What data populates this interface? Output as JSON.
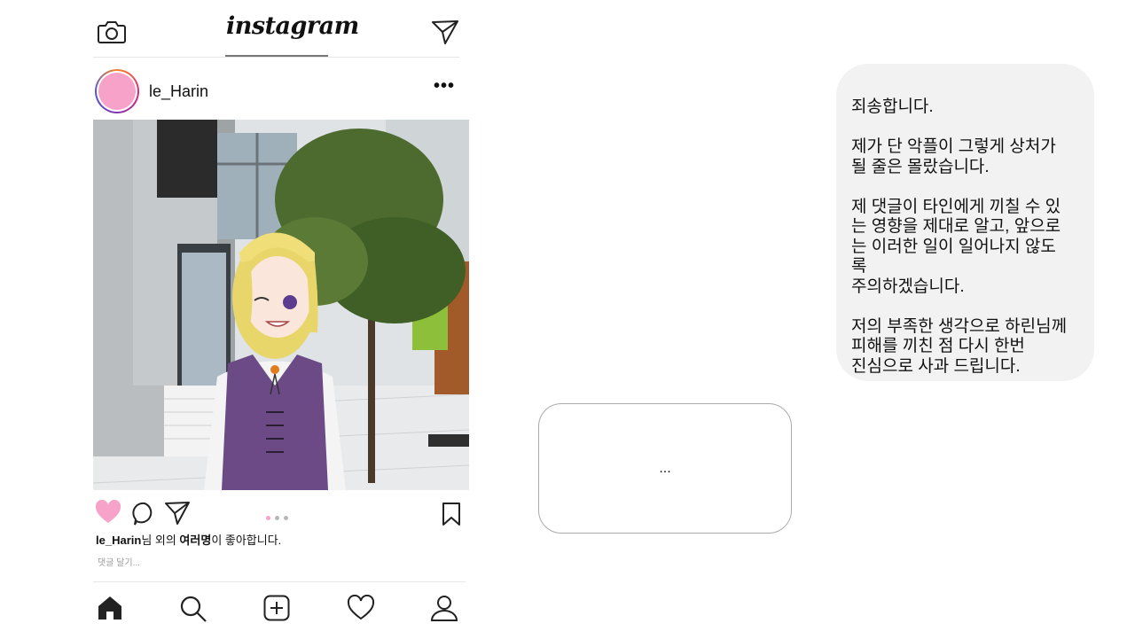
{
  "header": {
    "brand": "instagram",
    "icons": [
      "camera-icon",
      "send-icon"
    ]
  },
  "post": {
    "username": "le_Harin",
    "likes": {
      "user": "le_Harin",
      "middle": "님 외의 ",
      "others": "여러명",
      "suffix": "이 좋아합니다."
    },
    "comment_placeholder": "댓글 달기...",
    "carousel_dots": 3,
    "carousel_active": 1,
    "liked": true
  },
  "actions_icons": [
    "heart-icon",
    "comment-icon",
    "share-icon",
    "bookmark-icon"
  ],
  "bottom_nav": [
    "home-icon",
    "search-icon",
    "add-post-icon",
    "activity-heart-icon",
    "profile-icon"
  ],
  "reply_box": {
    "text": "..."
  },
  "chat": {
    "message": "죄송합니다.\n\n제가 단 악플이 그렇게 상처가\n될 줄은 몰랐습니다.\n\n제 댓글이 타인에게 끼칠 수 있\n는 영향을 제대로 알고, 앞으로\n는 이러한 일이 일어나지 않도\n록\n주의하겠습니다.\n\n저의 부족한 생각으로 하린님께\n피해를 끼친 점 다시 한번\n진심으로 사과 드립니다."
  },
  "colors": {
    "avatar": "#f7a2c8",
    "heart": "#f7a2c8",
    "bubble": "#f2f2f2"
  }
}
